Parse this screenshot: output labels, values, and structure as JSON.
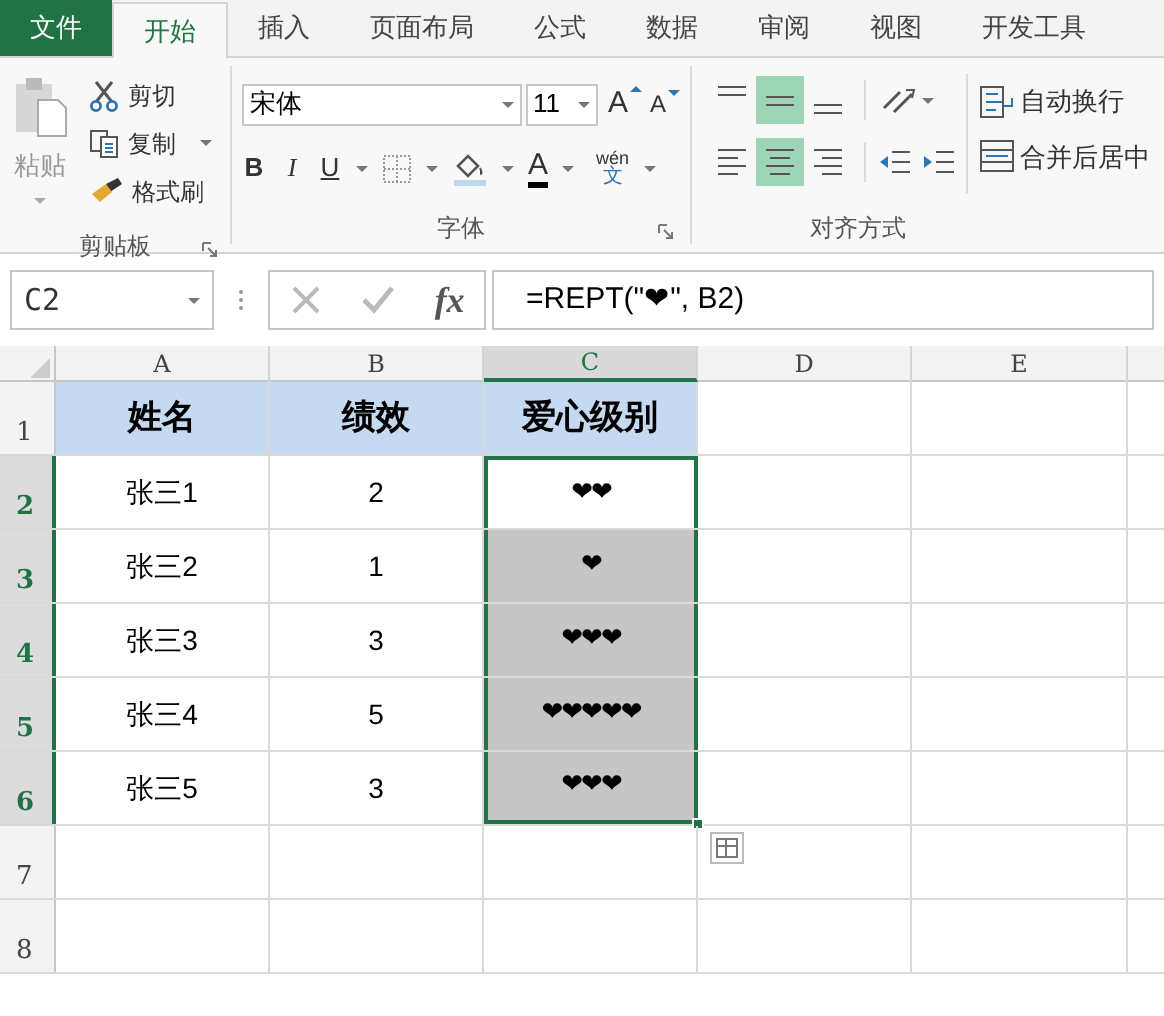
{
  "tabs": [
    {
      "label": "文件",
      "kind": "file",
      "selected": false
    },
    {
      "label": "开始",
      "kind": "tab",
      "selected": true
    },
    {
      "label": "插入",
      "kind": "tab",
      "selected": false
    },
    {
      "label": "页面布局",
      "kind": "tab",
      "selected": false
    },
    {
      "label": "公式",
      "kind": "tab",
      "selected": false
    },
    {
      "label": "数据",
      "kind": "tab",
      "selected": false
    },
    {
      "label": "审阅",
      "kind": "tab",
      "selected": false
    },
    {
      "label": "视图",
      "kind": "tab",
      "selected": false
    },
    {
      "label": "开发工具",
      "kind": "tab",
      "selected": false
    }
  ],
  "clipboard": {
    "paste": "粘贴",
    "cut": "剪切",
    "copy": "复制",
    "format_painter": "格式刷",
    "group": "剪贴板"
  },
  "font": {
    "name": "宋体",
    "size": "11",
    "grow": "A",
    "shrink": "A",
    "bold": "B",
    "italic": "I",
    "underline": "U",
    "font_color": "A",
    "phonetic_top": "wén",
    "phonetic_bottom": "文",
    "group": "字体"
  },
  "alignment": {
    "vertical": [
      {
        "selected": false
      },
      {
        "selected": true
      },
      {
        "selected": false
      }
    ],
    "horizontal": [
      {
        "selected": false
      },
      {
        "selected": true
      },
      {
        "selected": false
      }
    ],
    "wrap": "自动换行",
    "merge": "合并后居中",
    "group": "对齐方式"
  },
  "formula_bar": {
    "name_box": "C2",
    "fx": "fx",
    "formula": "=REPT(\"❤\", B2)"
  },
  "sheet": {
    "columns": [
      {
        "label": "A",
        "selected": false
      },
      {
        "label": "B",
        "selected": false
      },
      {
        "label": "C",
        "selected": true
      },
      {
        "label": "D",
        "selected": false
      },
      {
        "label": "E",
        "selected": false
      }
    ],
    "rows": [
      {
        "label": "1",
        "selected": false,
        "active": false,
        "kind": "header",
        "cells": [
          "姓名",
          "绩效",
          "爱心级别"
        ]
      },
      {
        "label": "2",
        "selected": true,
        "active": true,
        "kind": "data",
        "cells": [
          "张三1",
          "2",
          "❤❤"
        ]
      },
      {
        "label": "3",
        "selected": true,
        "active": false,
        "kind": "data",
        "cells": [
          "张三2",
          "1",
          "❤"
        ]
      },
      {
        "label": "4",
        "selected": true,
        "active": false,
        "kind": "data",
        "cells": [
          "张三3",
          "3",
          "❤❤❤"
        ]
      },
      {
        "label": "5",
        "selected": true,
        "active": false,
        "kind": "data",
        "cells": [
          "张三4",
          "5",
          "❤❤❤❤❤"
        ]
      },
      {
        "label": "6",
        "selected": true,
        "active": false,
        "kind": "data",
        "cells": [
          "张三5",
          "3",
          "❤❤❤"
        ]
      },
      {
        "label": "7",
        "selected": false,
        "active": false,
        "kind": "data",
        "cells": []
      },
      {
        "label": "8",
        "selected": false,
        "active": false,
        "kind": "data",
        "cells": []
      }
    ]
  }
}
